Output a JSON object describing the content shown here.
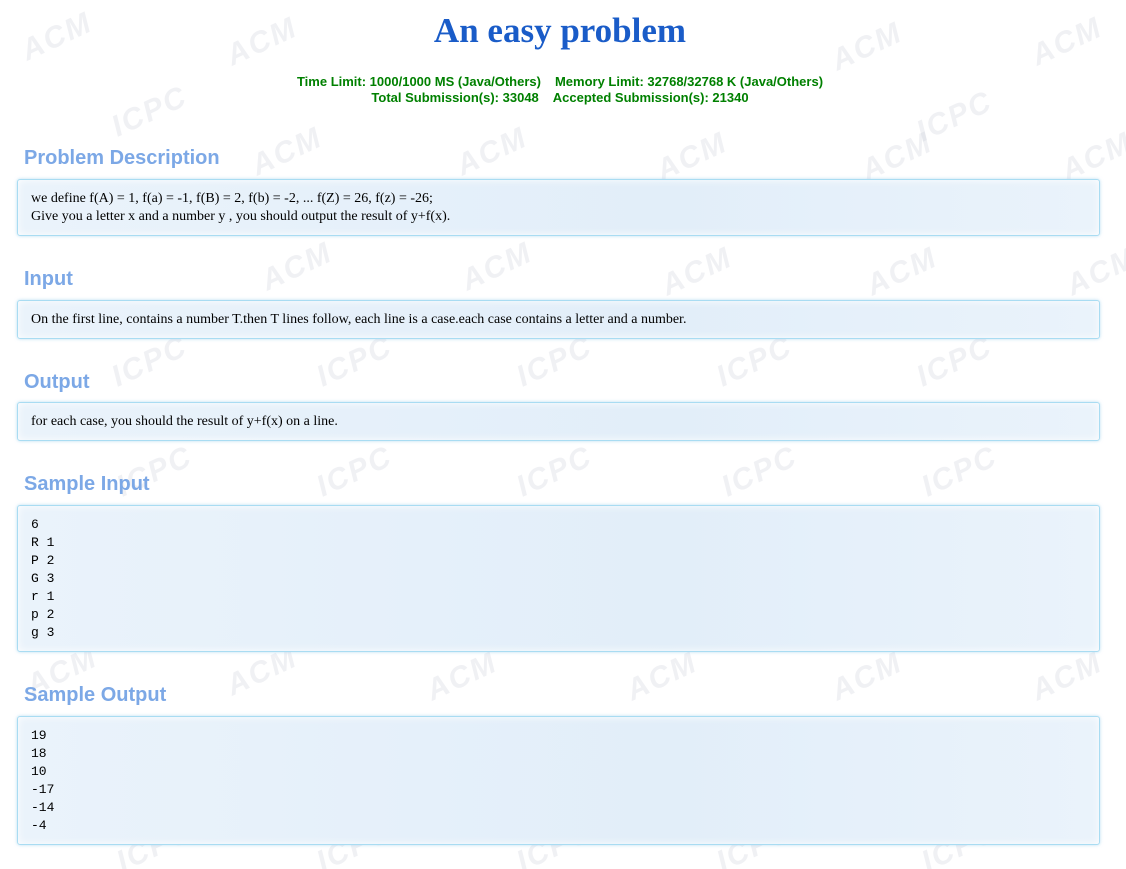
{
  "problem": {
    "title": "An easy problem",
    "time_limit": "Time Limit: 1000/1000 MS (Java/Others)",
    "memory_limit": "Memory Limit: 32768/32768 K (Java/Others)",
    "total_submissions": "Total Submission(s): 33048",
    "accepted_submissions": "Accepted Submission(s): 21340"
  },
  "sections": {
    "description": {
      "heading": "Problem Description",
      "lines": [
        "we define f(A) = 1, f(a) = -1, f(B) = 2, f(b) = -2, ... f(Z) = 26, f(z) = -26;",
        "Give you a letter x and a number y , you should output the result of y+f(x)."
      ]
    },
    "input": {
      "heading": "Input",
      "lines": [
        "On the first line, contains a number T.then T lines follow, each line is a case.each case contains a letter and a number."
      ]
    },
    "output": {
      "heading": "Output",
      "lines": [
        "for each case, you should the result of y+f(x) on a line."
      ]
    },
    "sample_input": {
      "heading": "Sample Input",
      "lines": [
        "6",
        "R 1",
        "P 2",
        "G 3",
        "r 1",
        "p 2",
        "g 3"
      ]
    },
    "sample_output": {
      "heading": "Sample Output",
      "lines": [
        "19",
        "18",
        "10",
        "-17",
        "-14",
        "-4"
      ]
    }
  },
  "watermark": {
    "acm": "ACM",
    "icpc": "ICPC",
    "color": "#c8cdd7"
  },
  "colors": {
    "title": "#1a5cc8",
    "limits": "#008000",
    "section_heading": "#7ca8e6",
    "panel_border": "#a9dcf2",
    "panel_bg": "#e2eef9"
  }
}
